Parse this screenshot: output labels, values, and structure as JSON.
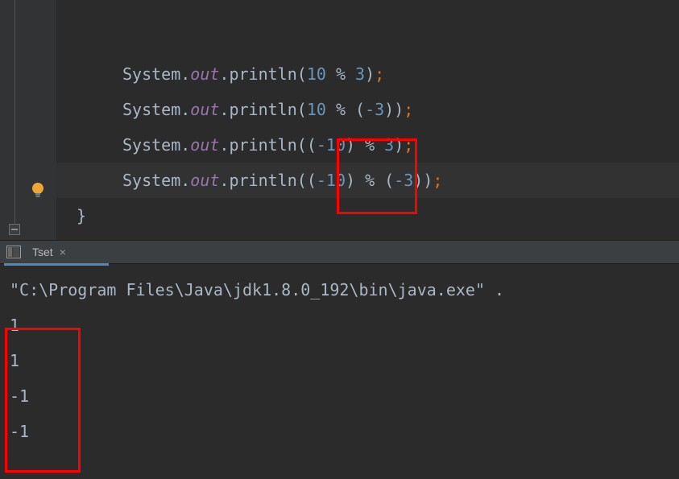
{
  "code": {
    "lines": [
      {
        "cls": "System",
        "field": "out",
        "method": "println",
        "arg_pre": "",
        "arg_num1": "10",
        "arg_mid": " % ",
        "arg_num2": "3",
        "arg_post": ""
      },
      {
        "cls": "System",
        "field": "out",
        "method": "println",
        "arg_pre": "",
        "arg_num1": "10",
        "arg_mid": " % (",
        "arg_num2": "-3",
        "arg_post": ")"
      },
      {
        "cls": "System",
        "field": "out",
        "method": "println",
        "arg_pre": "(",
        "arg_num1": "-10",
        "arg_mid": ") % ",
        "arg_num2": "3",
        "arg_post": ""
      },
      {
        "cls": "System",
        "field": "out",
        "method": "println",
        "arg_pre": "(",
        "arg_num1": "-10",
        "arg_mid": ") % (",
        "arg_num2": "-3",
        "arg_post": ")"
      }
    ],
    "closing_brace": "}"
  },
  "run_tab": {
    "label": "Tset"
  },
  "console": {
    "command": "\"C:\\Program Files\\Java\\jdk1.8.0_192\\bin\\java.exe\" .",
    "output": [
      "1",
      "1",
      "-1",
      "-1"
    ]
  }
}
